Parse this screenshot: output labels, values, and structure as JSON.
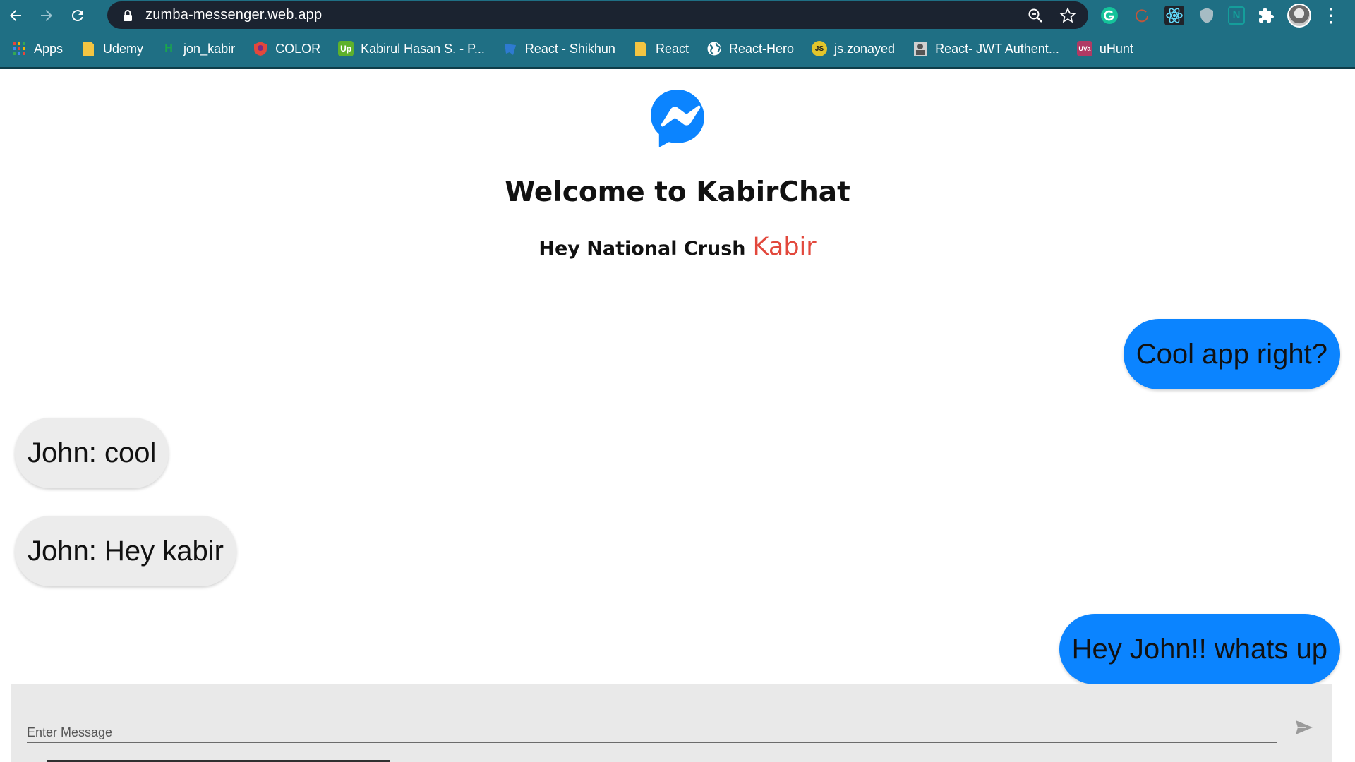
{
  "browser": {
    "url": "zumba-messenger.web.app",
    "nav": {
      "back_icon": "arrow-left-icon",
      "forward_icon": "arrow-right-icon",
      "reload_icon": "reload-icon"
    },
    "bookmarks": [
      {
        "label": "Apps",
        "icon": "apps-grid-icon",
        "color": "#e8453c"
      },
      {
        "label": "Udemy",
        "icon": "folder-icon",
        "color": "#f4c542"
      },
      {
        "label": "jon_kabir",
        "icon": "hackerrank-icon",
        "color": "#1aa84a"
      },
      {
        "label": "COLOR",
        "icon": "color-icon",
        "color": "#e2483c"
      },
      {
        "label": "Kabirul Hasan S. - P...",
        "icon": "upwork-icon",
        "color": "#5eb12b"
      },
      {
        "label": "React - Shikhun",
        "icon": "react-shikhun-icon",
        "color": "#2e7ad1"
      },
      {
        "label": "React",
        "icon": "folder-icon",
        "color": "#f4c542"
      },
      {
        "label": "React-Hero",
        "icon": "globe-icon",
        "color": "#ffffff"
      },
      {
        "label": "js.zonayed",
        "icon": "js-icon",
        "color": "#e3c52b"
      },
      {
        "label": "React- JWT Authent...",
        "icon": "jwt-icon",
        "color": "#d0d0d0"
      },
      {
        "label": "uHunt",
        "icon": "uhunt-icon",
        "color": "#b03a64"
      }
    ]
  },
  "app": {
    "title": "Welcome to KabirChat",
    "greeting": "Hey National Crush",
    "username": "Kabir",
    "messages": [
      {
        "text": "Cool app right?",
        "sender": "me"
      },
      {
        "text": "John: cool",
        "sender": "them"
      },
      {
        "text": "John: Hey kabir",
        "sender": "them"
      },
      {
        "text": "Hey John!! whats up",
        "sender": "me"
      }
    ],
    "input": {
      "placeholder": "Enter Message",
      "value": ""
    },
    "colors": {
      "outgoing": "#0b84ff",
      "incoming": "#ececec",
      "username": "#e2483c",
      "logo": "#0b84ff"
    }
  }
}
